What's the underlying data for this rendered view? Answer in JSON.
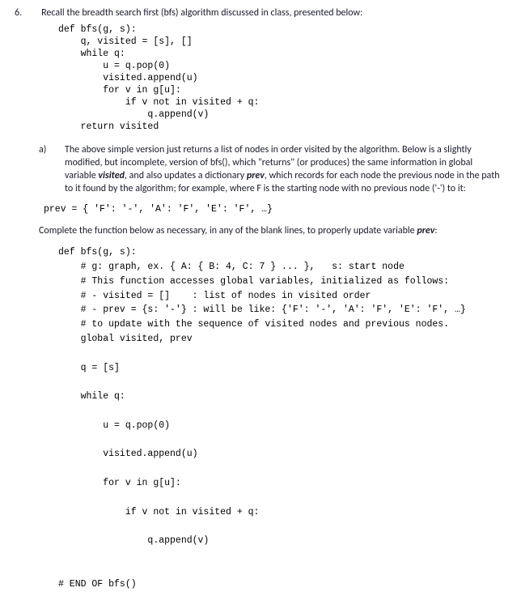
{
  "q_num": "6.",
  "q_text": "Recall the breadth search first (bfs) algorithm discussed in class, presented below:",
  "code1": "def bfs(g, s):\n    q, visited = [s], []\n    while q:\n        u = q.pop(0)\n        visited.append(u)\n        for v in g[u]:\n            if v not in visited + q:\n                q.append(v)\n    return visited",
  "part_letter": "a)",
  "part_a_1": "The above simple version just returns a list of nodes in order visited by the algorithm.  Below is a slightly modified, but incomplete, version of bfs(), which \"returns\" (or produces) the same information in global variable ",
  "part_a_visited": "visited",
  "part_a_2": ", and also updates a dictionary ",
  "part_a_prev": "prev",
  "part_a_3": ", which records for each node the previous node in the path to it found by the algorithm; for example, where F is the starting node with no previous node ('-') to it:",
  "prev_line": "prev = { 'F': '-', 'A': 'F', 'E': 'F', …}",
  "complete_1": "Complete the function below as necessary, in any of the blank lines, to properly update variable ",
  "complete_prev": "prev",
  "complete_2": ":",
  "code2": "def bfs(g, s):\n    # g: graph, ex. { A: { B: 4, C: 7 } ... },   s: start node\n    # This function accesses global variables, initialized as follows:\n    # - visited = []    : list of nodes in visited order\n    # - prev = {s: '-'} : will be like: {'F': '-', 'A': 'F', 'E': 'F', …}\n    # to update with the sequence of visited nodes and previous nodes.\n    global visited, prev\n\n    q = [s]\n\n    while q:\n\n        u = q.pop(0)\n\n        visited.append(u)\n\n        for v in g[u]:\n\n            if v not in visited + q:\n\n                q.append(v)\n\n\n# END OF bfs()"
}
